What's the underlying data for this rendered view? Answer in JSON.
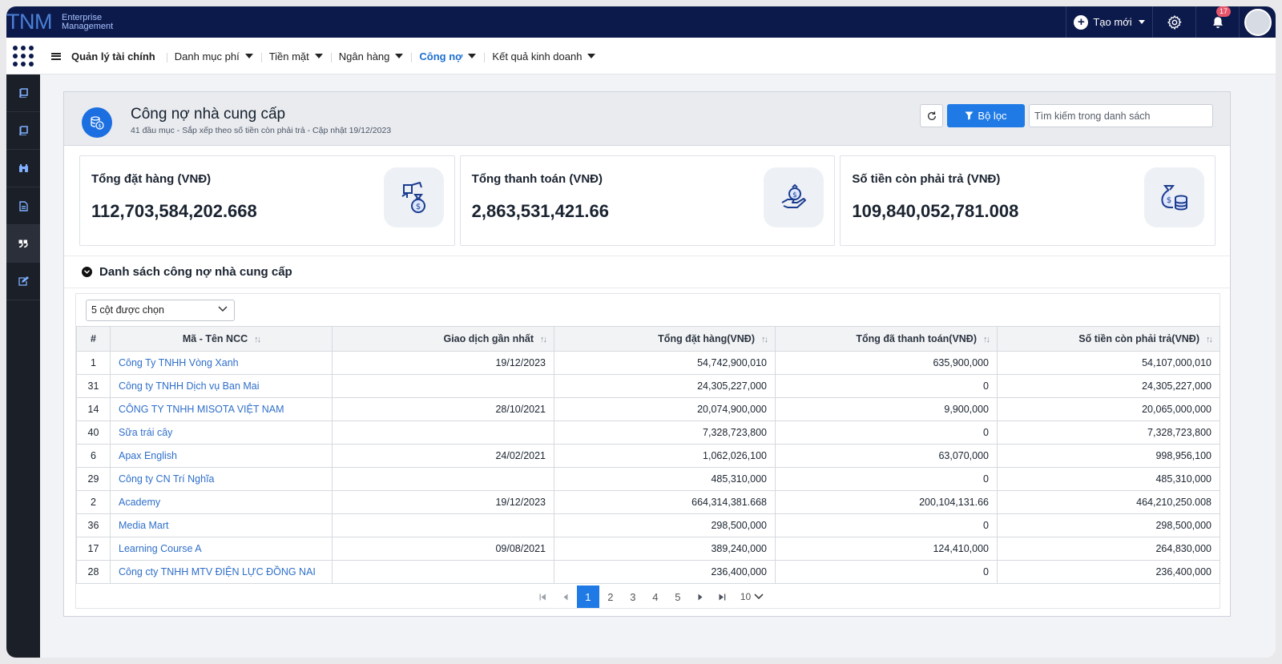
{
  "app": {
    "logo": "TNM",
    "brand_line1": "Enterprise",
    "brand_line2": "Management"
  },
  "topbar": {
    "create_label": "Tạo mới",
    "notification_count": "17"
  },
  "menu": {
    "items": [
      {
        "label": "Quản lý tài chính"
      },
      {
        "label": "Danh mục phí"
      },
      {
        "label": "Tiền mặt"
      },
      {
        "label": "Ngân hàng"
      },
      {
        "label": "Công nợ"
      },
      {
        "label": "Kết quả kinh doanh"
      }
    ],
    "active": "Công nợ"
  },
  "page": {
    "title": "Công nợ nhà cung cấp",
    "subtitle": "41 đầu mục - Sắp xếp theo số tiền còn phải trả - Cập nhật 19/12/2023",
    "filter_label": "Bộ lọc",
    "search_placeholder": "Tìm kiếm trong danh sách"
  },
  "stats": [
    {
      "label": "Tổng đặt hàng (VNĐ)",
      "value": "112,703,584,202.668",
      "icon": "money-bag-hand-icon"
    },
    {
      "label": "Tổng thanh toán (VNĐ)",
      "value": "2,863,531,421.66",
      "icon": "payment-hand-icon"
    },
    {
      "label": "Số tiền còn phải trả (VNĐ)",
      "value": "109,840,052,781.008",
      "icon": "money-bag-coins-icon"
    }
  ],
  "list": {
    "title": "Danh sách công nợ nhà cung cấp",
    "columns_selected": "5 cột được chọn",
    "headers": [
      "#",
      "Mã - Tên NCC",
      "Giao dịch gần nhất",
      "Tổng đặt hàng(VNĐ)",
      "Tổng đã thanh toán(VNĐ)",
      "Số tiền còn phải trả(VNĐ)"
    ],
    "rows": [
      [
        "1",
        "Công Ty TNHH Vòng Xanh",
        "19/12/2023",
        "54,742,900,010",
        "635,900,000",
        "54,107,000,010"
      ],
      [
        "31",
        "Công ty TNHH Dịch vụ Ban Mai",
        "",
        "24,305,227,000",
        "0",
        "24,305,227,000"
      ],
      [
        "14",
        "CÔNG TY TNHH MISOTA VIỆT NAM",
        "28/10/2021",
        "20,074,900,000",
        "9,900,000",
        "20,065,000,000"
      ],
      [
        "40",
        "Sữa trái cây",
        "",
        "7,328,723,800",
        "0",
        "7,328,723,800"
      ],
      [
        "6",
        "Apax English",
        "24/02/2021",
        "1,062,026,100",
        "63,070,000",
        "998,956,100"
      ],
      [
        "29",
        "Công ty CN Trí Nghĩa",
        "",
        "485,310,000",
        "0",
        "485,310,000"
      ],
      [
        "2",
        "Academy",
        "19/12/2023",
        "664,314,381.668",
        "200,104,131.66",
        "464,210,250.008"
      ],
      [
        "36",
        "Media Mart",
        "",
        "298,500,000",
        "0",
        "298,500,000"
      ],
      [
        "17",
        "Learning Course A",
        "09/08/2021",
        "389,240,000",
        "124,410,000",
        "264,830,000"
      ],
      [
        "28",
        "Công cty TNHH MTV ĐIỆN LỰC ĐỒNG NAI",
        "",
        "236,400,000",
        "0",
        "236,400,000"
      ]
    ]
  },
  "pagination": {
    "pages": [
      "1",
      "2",
      "3",
      "4",
      "5"
    ],
    "current": "1",
    "per_page": "10"
  },
  "colors": {
    "topbar": "#0c1a4b",
    "accent": "#1f7ae6",
    "link": "#2f6fca",
    "sidebar": "#1b1f27"
  },
  "sidebar_icons": [
    "book-icon",
    "book-icon",
    "binoculars-icon",
    "document-icon",
    "quote-icon",
    "edit-icon"
  ]
}
